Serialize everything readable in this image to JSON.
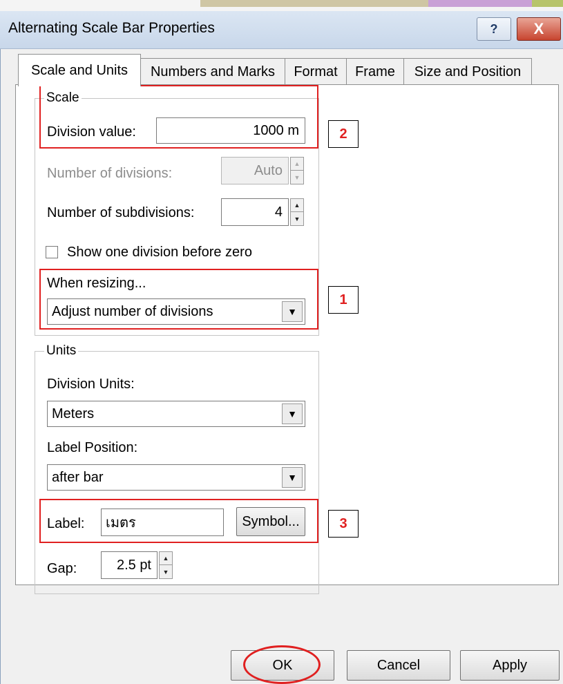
{
  "window": {
    "title": "Alternating Scale Bar Properties",
    "help_glyph": "?",
    "close_glyph": "X"
  },
  "tabs": [
    {
      "label": "Scale and Units"
    },
    {
      "label": "Numbers and Marks"
    },
    {
      "label": "Format"
    },
    {
      "label": "Frame"
    },
    {
      "label": "Size and Position"
    }
  ],
  "scale": {
    "legend": "Scale",
    "division_value_label": "Division value:",
    "division_value": "1000 m",
    "num_divisions_label": "Number of divisions:",
    "num_divisions": "Auto",
    "num_subdivisions_label": "Number of subdivisions:",
    "num_subdivisions": "4",
    "show_one_label": "Show one division before zero",
    "when_resizing_label": "When resizing...",
    "when_resizing_value": "Adjust number of divisions"
  },
  "units": {
    "legend": "Units",
    "division_units_label": "Division Units:",
    "division_units_value": "Meters",
    "label_position_label": "Label Position:",
    "label_position_value": "after bar",
    "label_label": "Label:",
    "label_value": "เมตร",
    "symbol_button": "Symbol...",
    "gap_label": "Gap:",
    "gap_value": "2.5 pt"
  },
  "buttons": {
    "ok": "OK",
    "cancel": "Cancel",
    "apply": "Apply"
  },
  "annotations": {
    "badge_1": "1",
    "badge_2": "2",
    "badge_3": "3"
  },
  "colors": {
    "annotation": "#e02020",
    "title_bar": "#c8d7ea"
  }
}
